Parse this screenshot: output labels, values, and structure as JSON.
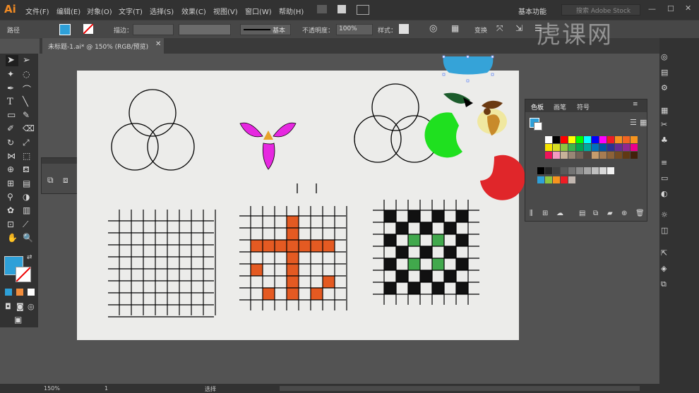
{
  "app": {
    "logo": "Ai"
  },
  "menu": [
    "文件(F)",
    "编辑(E)",
    "对象(O)",
    "文字(T)",
    "选择(S)",
    "效果(C)",
    "视图(V)",
    "窗口(W)",
    "帮助(H)"
  ],
  "workspace": {
    "name": "基本功能",
    "search_placeholder": "搜索 Adobe Stock"
  },
  "control": {
    "object_type": "路径",
    "stroke_label": "描边：",
    "stroke_style": "基本",
    "opacity_label": "不透明度：",
    "opacity_value": "100%",
    "style_label": "样式：",
    "transform_label": "变换"
  },
  "document": {
    "tab_title": "未标题-1.ai* @ 150% (RGB/预览)"
  },
  "swatches_panel": {
    "tabs": [
      "色板",
      "画笔",
      "符号"
    ],
    "colors": {
      "fill": "#2ea0d8",
      "row1": [
        "#ffffff",
        "#000000",
        "#ff0000",
        "#ffff00",
        "#00ff00",
        "#00ffff",
        "#0000ff",
        "#ff00ff",
        "#ee1c24",
        "#f7931e",
        "#f26522",
        "#f7941d"
      ],
      "row2": [
        "#f7e400",
        "#d7df23",
        "#8dc63f",
        "#39b54a",
        "#00a651",
        "#00a99d",
        "#0072bc",
        "#0054a6",
        "#2e3192",
        "#662d91",
        "#92278f",
        "#ec008c"
      ],
      "row3": [
        "#ed145b",
        "#f49ac1",
        "#c7b299",
        "#998675",
        "#736357",
        "#534741",
        "#c69c6d",
        "#a67c52",
        "#8c6239",
        "#754c24",
        "#603913",
        "#42210b"
      ],
      "gray_row": [
        "#000000",
        "#262626",
        "#404040",
        "#595959",
        "#737373",
        "#8c8c8c",
        "#a6a6a6",
        "#bfbfbf",
        "#d9d9d9",
        "#f2f2f2"
      ],
      "group_row": [
        "#2ea0d8",
        "#8dc63f",
        "#f7931e",
        "#ee1c24",
        "#c2b7b0"
      ]
    }
  },
  "status": {
    "zoom": "150%",
    "artboard_index": "1",
    "tool_name": "选择"
  },
  "watermark": "虎课网",
  "artwork_colors": {
    "magenta": "#e628e0",
    "orange": "#e8a32a",
    "green": "#1fe01f",
    "red": "#e0262a",
    "blue": "#35a3d8",
    "darkgreen": "#1c5c2c",
    "brown": "#6b3a12",
    "cross": "#e45a22",
    "check_green": "#41a84c"
  }
}
